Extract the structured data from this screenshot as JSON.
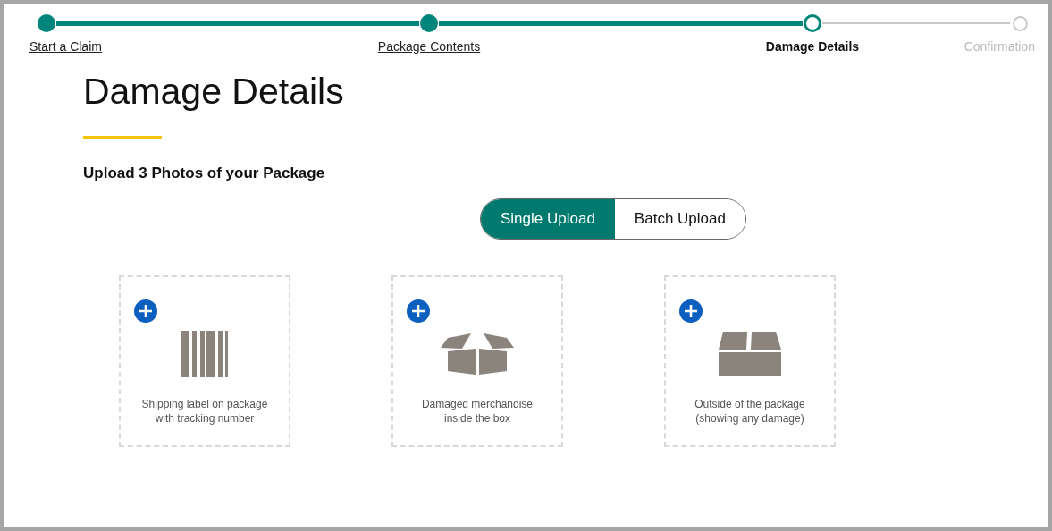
{
  "steps": [
    {
      "label": "Start a Claim",
      "completed": true,
      "current": false
    },
    {
      "label": "Package Contents",
      "completed": true,
      "current": false
    },
    {
      "label": "Damage Details",
      "completed": false,
      "current": true
    },
    {
      "label": "Confirmation",
      "completed": false,
      "current": false
    }
  ],
  "title": "Damage Details",
  "subtitle": "Upload 3 Photos of your Package",
  "upload_modes": [
    {
      "label": "Single Upload",
      "selected": true
    },
    {
      "label": "Batch Upload",
      "selected": false
    }
  ],
  "photo_slots": [
    {
      "kind": "barcode",
      "label": "Shipping label on package with tracking number"
    },
    {
      "kind": "open-box",
      "label": "Damaged merchandise inside the box"
    },
    {
      "kind": "closed-box",
      "label": "Outside of the package (showing any damage)"
    }
  ]
}
